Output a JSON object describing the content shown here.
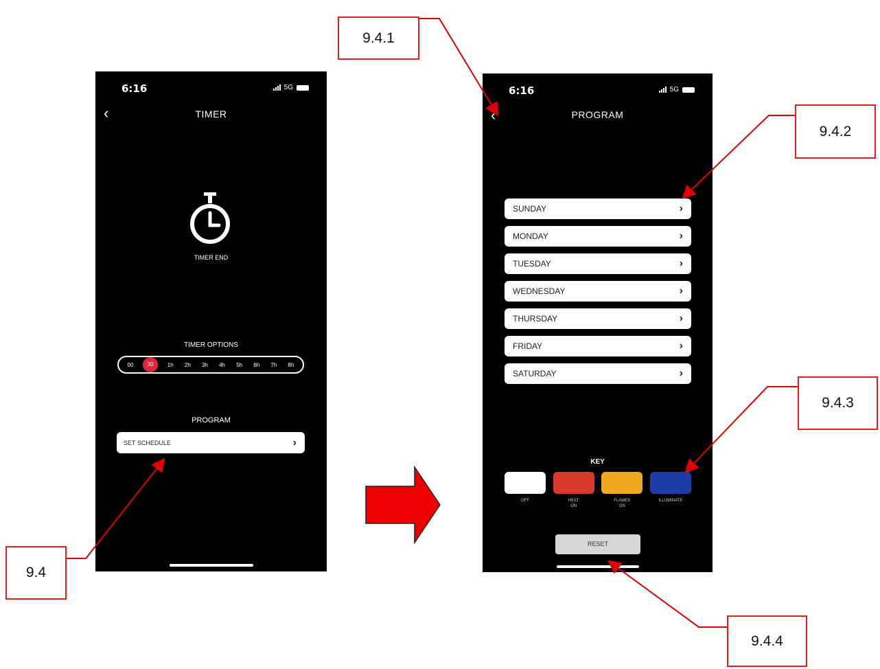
{
  "phone1": {
    "status_time": "6:16",
    "network": "5G",
    "back_icon": "chevron-left-icon",
    "title": "TIMER",
    "timer_icon": "stopwatch-icon",
    "timer_end_label": "TIMER END",
    "options_label": "TIMER OPTIONS",
    "options": [
      "00",
      "30",
      "1h",
      "2h",
      "3h",
      "4h",
      "5h",
      "6h",
      "7h",
      "8h"
    ],
    "selected_option": "30",
    "program_label": "PROGRAM",
    "schedule_label": "SET SCHEDULE"
  },
  "phone2": {
    "status_time": "6:16",
    "network": "5G",
    "back_icon": "chevron-left-icon",
    "title": "PROGRAM",
    "days": [
      "SUNDAY",
      "MONDAY",
      "TUESDAY",
      "WEDNESDAY",
      "THURSDAY",
      "FRIDAY",
      "SATURDAY"
    ],
    "key_label": "KEY",
    "keys": [
      {
        "label": "OFF",
        "color": "#ffffff"
      },
      {
        "label": "HEAT\nON",
        "color": "#d9392a"
      },
      {
        "label": "FLAMES\nON",
        "color": "#f0a81f"
      },
      {
        "label": "ILLUMINATE",
        "color": "#1e3ca8"
      }
    ],
    "reset_label": "RESET"
  },
  "annotations": {
    "callout_9_4": "9.4",
    "callout_9_4_1": "9.4.1",
    "callout_9_4_2": "9.4.2",
    "callout_9_4_3": "9.4.3",
    "callout_9_4_4": "9.4.4",
    "arrow_color": "#e00000",
    "transition_arrow_icon": "right-arrow-icon"
  }
}
